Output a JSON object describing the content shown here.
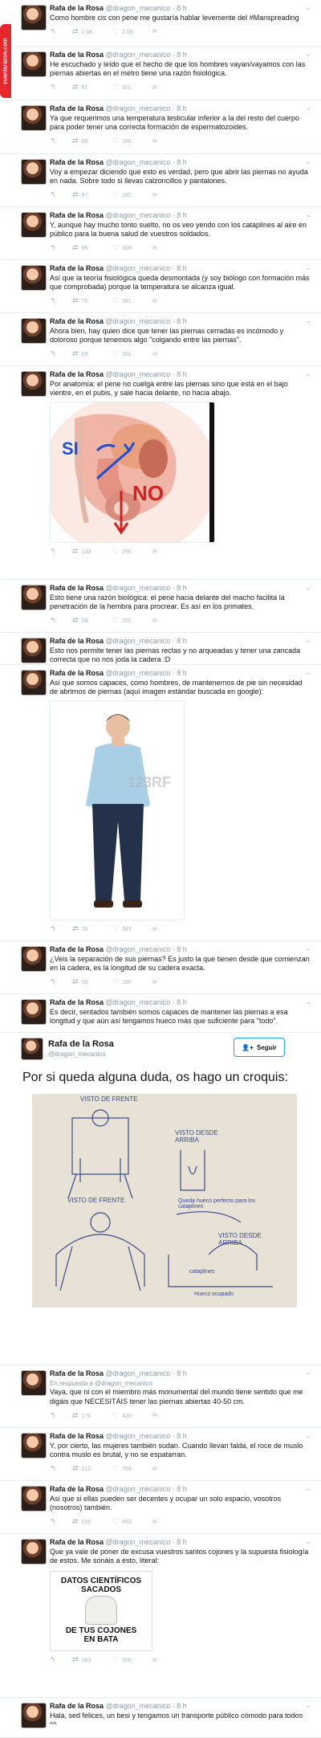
{
  "watermark": "cuantarazon.com",
  "author": {
    "name": "Rafa de la Rosa",
    "handle": "@dragon_mecanico",
    "time": "· 8 h"
  },
  "tweets": [
    {
      "text": "Como hombre cis con pene me gustaría hablar levemente del #Manspreading",
      "rt": "2,6K",
      "like": "2,0K"
    },
    {
      "text": "He escuchado y leído que el hecho de que los hombres vayan/vayamos con las piernas abiertas en el metro tiene una razón fisiológica.",
      "rt": "81",
      "like": "301"
    },
    {
      "text": "Ya que requerimos una temperatura testicular inferior a la del resto del cuerpo para poder tener una correcta formación de espermatozoides.",
      "rt": "68",
      "like": "186"
    },
    {
      "text": "Voy a empezar diciendo que esto es verdad, pero que abrir las piernas no ayuda en nada. Sobre todo si llevas calzoncillos y pantalones.",
      "rt": "87",
      "like": "292"
    },
    {
      "text": "Y, aunque hay mucho tonto suelto, no os veo yendo con los cataplines al aire en público para la buena salud de vuestros soldados.",
      "rt": "65",
      "like": "339"
    },
    {
      "text": "Así que la teoría fisiológica queda desmontada (y soy biólogo con formación más que comprobada) porque la temperatura se alcanza igual.",
      "rt": "75",
      "like": "281"
    },
    {
      "text": "Ahora bien, hay quien dice que tener las piernas cerradas es incómodo y doloroso porque tenemos algo \"colgando entre las piernas\".",
      "rt": "69",
      "like": "301"
    },
    {
      "text": "Por anatomía: el pene no cuelga entre las piernas sino que está en el bajo vientre, en el pubis, y sale hacia delante, no hacia abajo.",
      "rt": "133",
      "like": "296",
      "img": {
        "si": "SI",
        "no": "NO"
      }
    },
    {
      "text": "Esto tiene una razón biológica: el pene hacia delante del macho facilita la penetración de la hembra para procrear. Es así en los primates.",
      "rt": "58",
      "like": "201"
    },
    {
      "text": "Esto nos permite tener las piernas rectas y no arqueadas y tener una zancada correcta que no nos joda la cadera :D"
    },
    {
      "text": "Así que somos capaces, como hombres, de mantenernos de pie sin necesidad de abrirnos de piernas (aquí imagen estándar buscada en google):",
      "rt": "76",
      "like": "347",
      "img": {
        "wm": "123RF"
      }
    },
    {
      "text": "¿Veis la separación de sus piernas? Es justo la que tienen desde que comienzan en la cadera, es la longitud de su cadera exacta.",
      "rt": "58",
      "like": "186"
    },
    {
      "text": "Es decir, sentados también somos capaces de mantener las piernas a esa longitud y que aún así tengamos hueco más que suficiente para \"todo\"."
    },
    {
      "big": true,
      "follow": "Seguir",
      "text": "Por si queda alguna duda, os hago un croquis:",
      "sketch": {
        "front_top": "VISTO DE FRENTE",
        "side": "VISTO DESDE ARRIBA",
        "front": "VISTO DE FRENTE",
        "top2": "VISTO DESDE ARRIBA",
        "note1": "Queda hueco perfecto para los cataplines",
        "note2": "cataplines",
        "note3": "Hueco ocupado"
      }
    },
    {
      "reply": "En respuesta a @dragon_mecanico",
      "text": "Vaya, que ni con el miembro más monumental del mundo tiene sentido que me digáis que NECESITÁIS tener las piernas abiertas 40-50 cm.",
      "rt": "174",
      "like": "420"
    },
    {
      "text": "Y, por cierto, las mujeres también sudan. Cuando llevan falda, el roce de muslo contra muslo es brutal, y no se espatarran.",
      "rt": "212",
      "like": "759"
    },
    {
      "text": "Así que si ellas pueden ser decentes y ocupar un solo espacio, vosotros (nosotros) también.",
      "rt": "155",
      "like": "459"
    },
    {
      "text": "Que ya vale de poner de excusa vuestros santos cojones y la supuesta fisiología de estos. Me sonáis a esto, literal:",
      "rt": "183",
      "like": "606",
      "meme": [
        "DATOS CIENTÍFICOS",
        "SACADOS",
        "DE TUS COJONES",
        "EN BATA"
      ]
    },
    {
      "text": "Hala, sed felices, un besi y tengamos un transporte público cómodo para todos ^^"
    }
  ]
}
